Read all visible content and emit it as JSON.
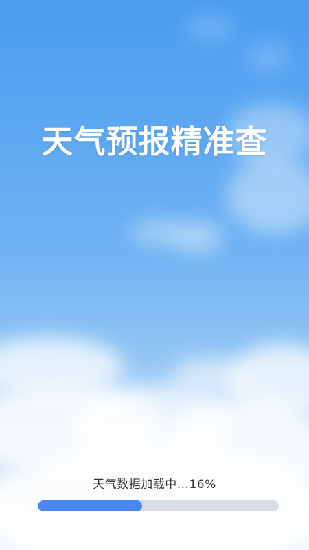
{
  "splash": {
    "title": "天气预报精准查",
    "background_color_top": "#4a9cf0",
    "background_color_bottom": "#e8f3fb"
  },
  "loading": {
    "prefix": "天气数据加载中...",
    "percent_text": "16%",
    "progress_fraction": 0.16,
    "track_color": "#d6dde6",
    "fill_color": "#4a86f3"
  }
}
